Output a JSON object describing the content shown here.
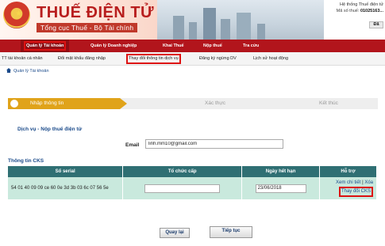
{
  "header": {
    "brand_title": "THUẾ ĐIỆN TỬ",
    "brand_subtitle": "Tổng cục Thuế - Bộ Tài chính",
    "system_label": "Hệ thống Thuế điện tử",
    "mst_label": "Mã số thuế:",
    "mst_value": "01025163...",
    "logout_label": "Đă"
  },
  "nav": {
    "items": [
      {
        "label": "Quản lý Tài khoản"
      },
      {
        "label": "Quản lý Doanh nghiệp"
      },
      {
        "label": "Khai Thuế"
      },
      {
        "label": "Nộp thuế"
      },
      {
        "label": "Tra cứu"
      }
    ]
  },
  "subnav": {
    "items": [
      {
        "label": "TT tài khoản cá nhân"
      },
      {
        "label": "Đổi mật khẩu đăng nhập"
      },
      {
        "label": "Thay đổi thông tin dịch vụ"
      },
      {
        "label": "Đăng ký ngừng DV"
      },
      {
        "label": "Lịch sử hoạt động"
      }
    ]
  },
  "breadcrumb": "Quản lý Tài khoản",
  "steps": [
    "Nhập thông tin",
    "Xác thực",
    "Kết thúc"
  ],
  "form": {
    "section_title": "Dịch vụ - Nộp thuế điện tử",
    "email_label": "Email",
    "email_value": "linh.mm10@gmail.com"
  },
  "cks": {
    "title": "Thông tin CKS",
    "headers": [
      "Số serial",
      "Tổ chức cấp",
      "Ngày hết hạn",
      "Hỗ trợ"
    ],
    "row": {
      "serial": "54 01 40 09 09 ce 60 0e 3d 3b 03 6c 07 56 5e",
      "issuer": "",
      "expiry": "23/06/2018",
      "view_label": "Xem chi tiết",
      "separator": "|",
      "delete_label": "Xóa",
      "change_label": "Thay đổi CKS"
    }
  },
  "buttons": {
    "back": "Quay lại",
    "next": "Tiếp tục"
  },
  "colors": {
    "nav_red": "#b2151c",
    "step_active": "#e0a31a",
    "table_header": "#2f6f73",
    "table_row": "#c9e9dd",
    "highlight_red": "#dd1111"
  }
}
